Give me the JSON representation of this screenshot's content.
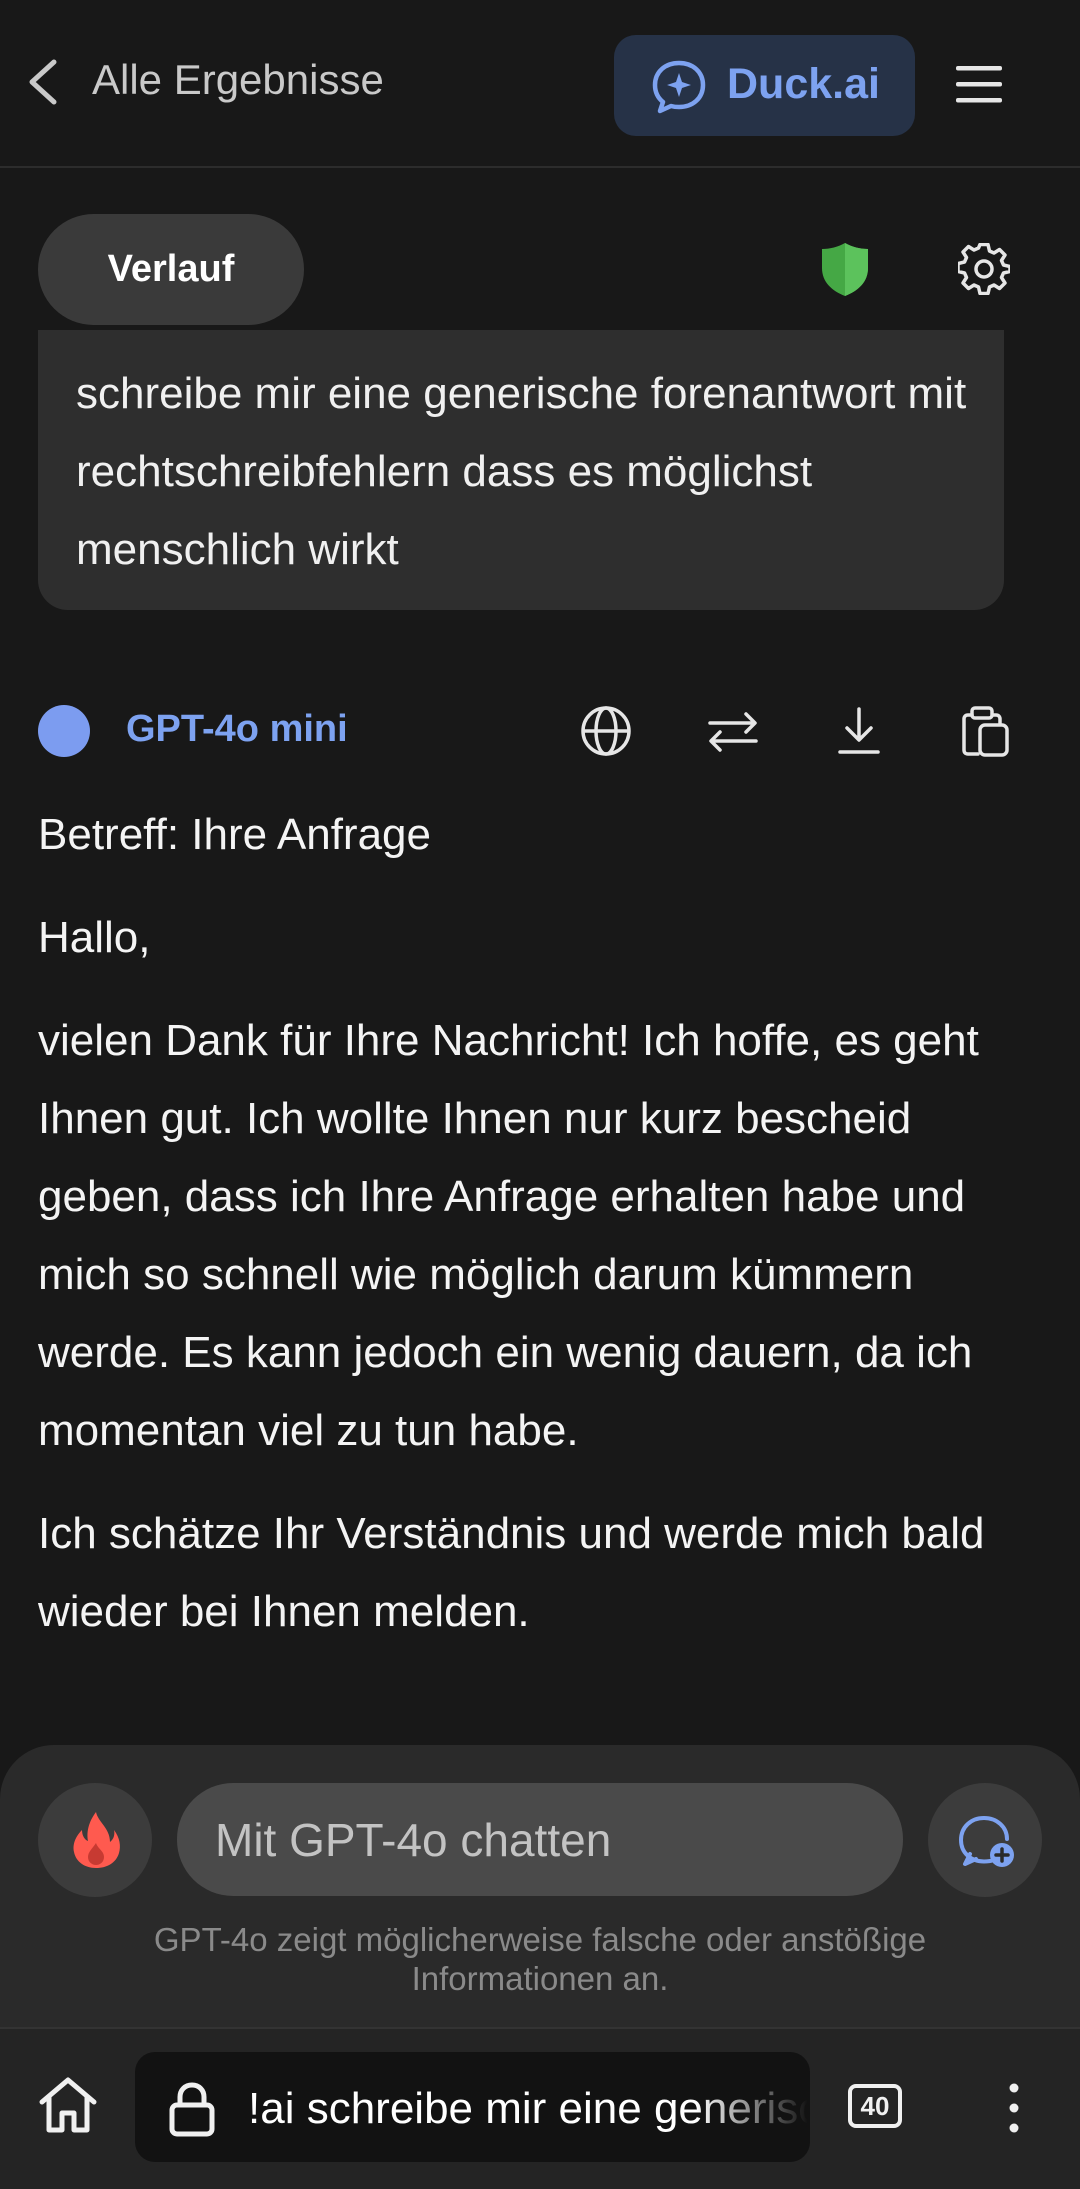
{
  "header": {
    "back_label": "Alle Ergebnisse",
    "brand_label": "Duck.ai"
  },
  "toolbar": {
    "history_label": "Verlauf"
  },
  "user_message": {
    "text": "schreibe mir eine generische forenantwort mit rechtschreibfehlern dass es möglichst menschlich wirkt"
  },
  "assistant": {
    "model_name": "GPT-4o mini",
    "paragraphs": [
      "Betreff: Ihre Anfrage",
      "Hallo,",
      "vielen Dank für Ihre Nachricht! Ich hoffe, es geht Ihnen gut. Ich wollte Ihnen nur kurz bescheid geben, dass ich Ihre Anfrage erhalten habe und mich so schnell wie möglich darum kümmern werde. Es kann jedoch ein wenig dauern, da ich momentan viel zu tun habe.",
      "Ich schätze Ihr Verständnis und werde mich bald wieder bei Ihnen melden."
    ]
  },
  "composer": {
    "placeholder": "Mit GPT-4o chatten",
    "disclaimer": "GPT-4o zeigt möglicherweise falsche oder anstößige Informationen an."
  },
  "browser": {
    "url_text": "!ai schreibe mir eine generische forenantwort",
    "tab_count": "40"
  },
  "colors": {
    "accent": "#7da2f0",
    "background": "#181818",
    "shield": "#4caf50",
    "fire": "#ff5a4f"
  },
  "icons": [
    "chevron-left-icon",
    "duck-ai-chat-icon",
    "hamburger-menu-icon",
    "shield-icon",
    "gear-icon",
    "globe-icon",
    "swap-arrows-icon",
    "download-icon",
    "copy-icon",
    "fire-icon",
    "new-chat-icon",
    "home-icon",
    "lock-icon",
    "kebab-menu-icon"
  ]
}
